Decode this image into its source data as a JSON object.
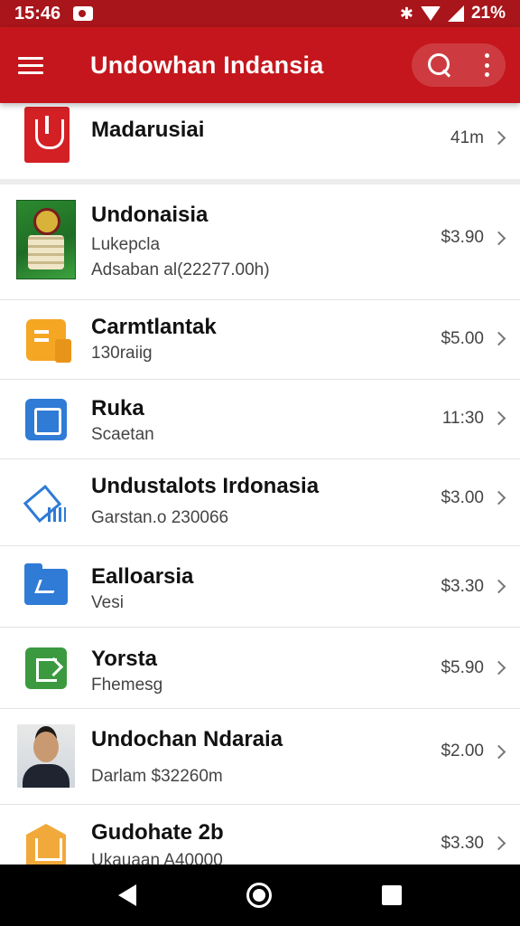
{
  "status_bar": {
    "time": "15:46",
    "battery_text": "21%"
  },
  "app_bar": {
    "title": "Undowhan Indansia"
  },
  "items": [
    {
      "title": "Madarusiai",
      "subtitle": "",
      "subtitle2": "",
      "price": "41m",
      "icon": "shield-logo-icon"
    },
    {
      "title": "Undonaisia",
      "subtitle": "Lukepcla",
      "subtitle2": "Adsaban al(22277.00h)",
      "price": "$3.90",
      "icon": "poster-thumbnail"
    },
    {
      "title": "Carmtlantak",
      "subtitle": "130raiig",
      "subtitle2": "",
      "price": "$5.00",
      "icon": "document-icon"
    },
    {
      "title": "Ruka",
      "subtitle": "Scaetan",
      "subtitle2": "",
      "price": "11:30",
      "icon": "edit-square-icon"
    },
    {
      "title": "Undustalots Irdonasia",
      "subtitle": "Garstan.o 230066",
      "subtitle2": "",
      "price": "$3.00",
      "icon": "chart-tool-icon"
    },
    {
      "title": "Ealloarsia",
      "subtitle": "Vesi",
      "subtitle2": "",
      "price": "$3.30",
      "icon": "folder-icon"
    },
    {
      "title": "Yorsta",
      "subtitle": "Fhemesg",
      "subtitle2": "",
      "price": "$5.90",
      "icon": "export-icon"
    },
    {
      "title": "Undochan Ndaraia",
      "subtitle": "",
      "subtitle2": "Darlam $32260m",
      "price": "$2.00",
      "icon": "avatar-photo"
    },
    {
      "title": "Gudohate 2b",
      "subtitle": "Ukauaan A40000",
      "subtitle2": "",
      "price": "$3.30",
      "icon": "gold-badge-icon"
    }
  ]
}
